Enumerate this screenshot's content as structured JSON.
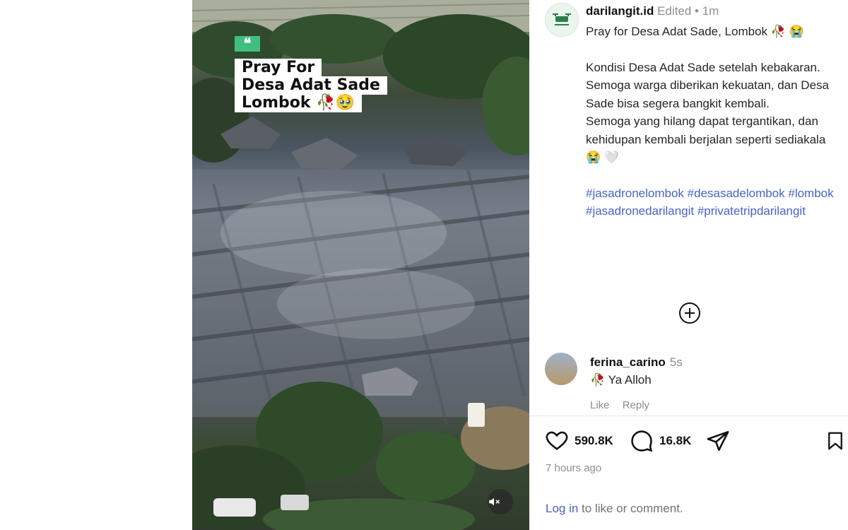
{
  "media": {
    "overlay": {
      "quote_mark": "❝",
      "lines": [
        "Pray For",
        "Desa Adat Sade",
        "Lombok 🥀🥹"
      ]
    },
    "mute_icon": "muted-speaker-icon"
  },
  "post": {
    "username": "darilangit.id",
    "edited": "Edited",
    "separator": "•",
    "time": "1m",
    "caption": {
      "title": "Pray for Desa Adat Sade, Lombok 🥀 😭",
      "body": [
        "Kondisi Desa Adat Sade setelah kebakaran.",
        "Semoga warga diberikan kekuatan, dan Desa Sade bisa segera bangkit kembali.",
        "Semoga yang hilang dapat tergantikan, dan kehidupan kembali berjalan seperti sediakala😭 🤍"
      ],
      "hashtags": [
        "#jasadronelombok",
        "#desasadelombok",
        "#lombok",
        "#jasadronedarilangit",
        "#privatetripdarilangit"
      ]
    }
  },
  "comment": {
    "username": "ferina_carino",
    "time": "5s",
    "text": "🥀 Ya Alloh",
    "like": "Like",
    "reply": "Reply"
  },
  "actions": {
    "likes": "590.8K",
    "comments": "16.8K"
  },
  "time_ago": "7 hours ago",
  "login": {
    "link": "Log in",
    "rest": " to like or comment."
  },
  "colors": {
    "link": "#4a63c9",
    "muted": "#8e8e8e",
    "overlay_accent": "#3fbf7f"
  }
}
